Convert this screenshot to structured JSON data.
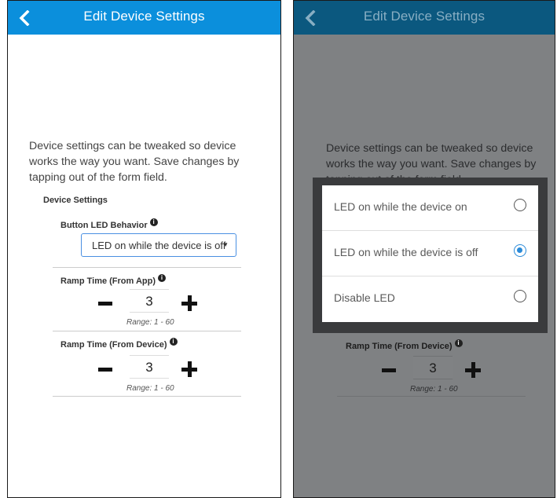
{
  "left_screen": {
    "title": "Edit Device Settings",
    "intro": "Device settings can be tweaked so device works the way you want. Save changes by tapping out of the form field.",
    "section_title": "Device Settings",
    "button_led": {
      "label": "Button LED Behavior",
      "info": "i",
      "selected": "LED on while the device is off",
      "caret": "▼"
    },
    "ramp_app": {
      "label": "Ramp Time (From App)",
      "info": "i",
      "value": "3",
      "range": "Range: 1 - 60"
    },
    "ramp_device": {
      "label": "Ramp Time (From Device)",
      "info": "i",
      "value": "3",
      "range": "Range: 1 - 60"
    }
  },
  "right_screen": {
    "title": "Edit Device Settings",
    "intro": "Device settings can be tweaked so device works the way you want. Save changes by tapping out of the form field.",
    "ramp_device": {
      "label": "Ramp Time (From Device)",
      "info": "i",
      "value": "3",
      "range": "Range: 1 - 60"
    },
    "options": [
      {
        "label": "LED on while the device on",
        "checked": false
      },
      {
        "label": "LED on while the device is off",
        "checked": true
      },
      {
        "label": "Disable LED",
        "checked": false
      }
    ]
  },
  "colors": {
    "appbar": "#0b8fdc",
    "appbar_dimmed": "#0b587f",
    "overlay": "#7f8183",
    "accent": "#2a8ad8"
  }
}
